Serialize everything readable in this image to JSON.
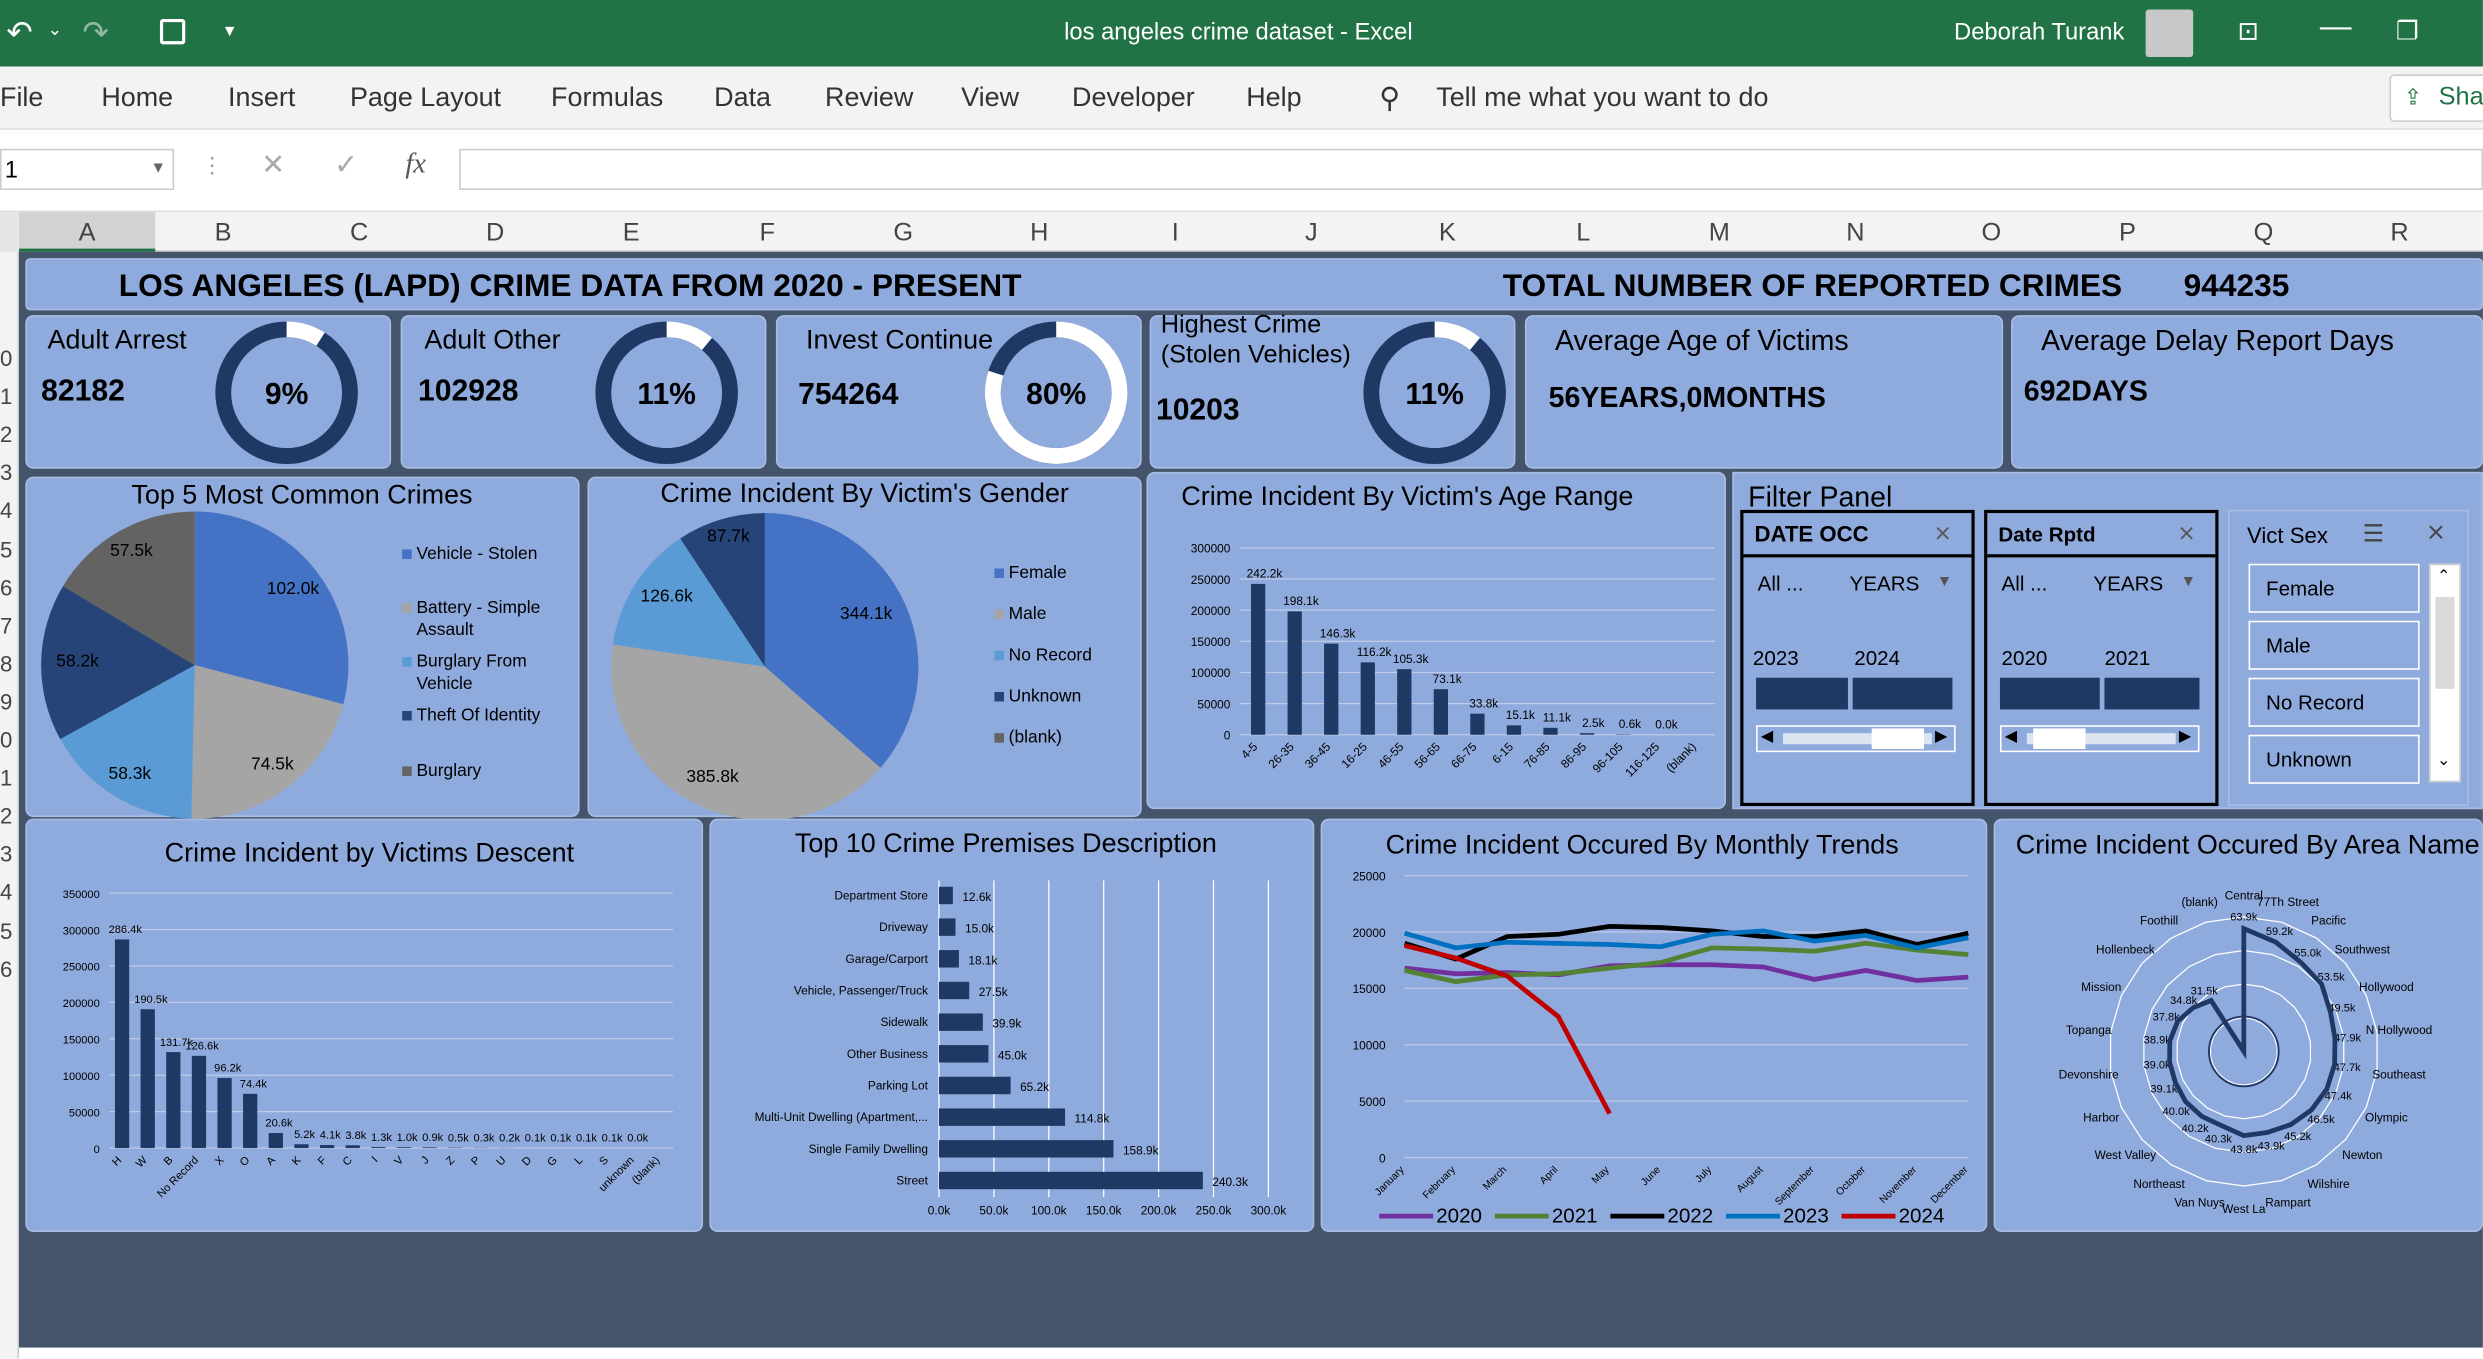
{
  "window": {
    "title": "los angeles crime dataset  -  Excel",
    "user": "Deborah Turank"
  },
  "ribbon": {
    "tabs": [
      "File",
      "Home",
      "Insert",
      "Page Layout",
      "Formulas",
      "Data",
      "Review",
      "View",
      "Developer",
      "Help"
    ],
    "tell_me": "Tell me what you want to do",
    "share": "Sha"
  },
  "formula_bar": {
    "name_box": "1",
    "fx": "fx",
    "value": ""
  },
  "columns": [
    "A",
    "B",
    "C",
    "D",
    "E",
    "F",
    "G",
    "H",
    "I",
    "J",
    "K",
    "L",
    "M",
    "N",
    "O",
    "P",
    "Q",
    "R"
  ],
  "rows": [
    "0",
    "1",
    "2",
    "3",
    "4",
    "5",
    "6",
    "7",
    "8",
    "9",
    "0",
    "1",
    "2",
    "3",
    "4",
    "5",
    "6"
  ],
  "dashboard": {
    "title": "LOS ANGELES (LAPD) CRIME DATA FROM 2020 - PRESENT",
    "total_label": "TOTAL NUMBER OF REPORTED CRIMES",
    "total_value": "944235",
    "kpis": [
      {
        "label": "Adult Arrest",
        "value": "82182",
        "pct": "9%",
        "pct_value": 9
      },
      {
        "label": "Adult Other",
        "value": "102928",
        "pct": "11%",
        "pct_value": 11
      },
      {
        "label": "Invest Continue",
        "value": "754264",
        "pct": "80%",
        "pct_value": 80
      },
      {
        "label": "Highest Crime\n(Stolen Vehicles)",
        "label1": "Highest Crime",
        "label2": "(Stolen Vehicles)",
        "value": "10203",
        "pct": "11%",
        "pct_value": 11
      }
    ],
    "avg_age": {
      "label": "Average Age of Victims",
      "value": "56YEARS,0MONTHS"
    },
    "avg_delay": {
      "label": "Average Delay Report Days",
      "value": "692DAYS"
    },
    "filter_panel": {
      "title": "Filter Panel",
      "date_occ": {
        "title": "DATE OCC",
        "all": "All ...",
        "period": "YEARS",
        "years": [
          "2023",
          "2024"
        ]
      },
      "date_rptd": {
        "title": "Date Rptd",
        "all": "All ...",
        "period": "YEARS",
        "years": [
          "2020",
          "2021"
        ]
      },
      "vict_sex": {
        "title": "Vict Sex",
        "options": [
          "Female",
          "Male",
          "No Record",
          "Unknown"
        ]
      }
    }
  },
  "colors": {
    "excel_green": "#217346",
    "card": "#8faadc",
    "canvas": "#44546a",
    "navy": "#1f3864"
  },
  "chart_data": [
    {
      "type": "pie",
      "title": "Top 5 Most Common Crimes",
      "categories": [
        "Vehicle - Stolen",
        "Battery - Simple Assault",
        "Burglary From Vehicle",
        "Theft Of Identity",
        "Burglary"
      ],
      "values": [
        102.0,
        74.5,
        58.3,
        58.2,
        57.5
      ],
      "labels": [
        "102.0k",
        "74.5k",
        "58.3k",
        "58.2k",
        "57.5k"
      ],
      "legend_lines": [
        [
          "Vehicle - Stolen"
        ],
        [
          "Battery - Simple",
          "Assault"
        ],
        [
          "Burglary From",
          "Vehicle"
        ],
        [
          "Theft Of Identity"
        ],
        [
          "Burglary"
        ]
      ],
      "colors": [
        "#4472c4",
        "#a5a5a5",
        "#5b9bd5",
        "#264478",
        "#636363"
      ]
    },
    {
      "type": "pie",
      "title": "Crime Incident By Victim's Gender",
      "categories": [
        "Female",
        "Male",
        "No Record",
        "Unknown",
        "(blank)"
      ],
      "values": [
        344.1,
        385.8,
        126.6,
        87.7,
        0
      ],
      "labels": [
        "344.1k",
        "385.8k",
        "126.6k",
        "87.7k",
        ""
      ],
      "colors": [
        "#4472c4",
        "#a5a5a5",
        "#5b9bd5",
        "#264478",
        "#636363"
      ]
    },
    {
      "type": "bar",
      "title": "Crime Incident By Victim's Age Range",
      "categories": [
        "4-5",
        "26-35",
        "36-45",
        "16-25",
        "46-55",
        "56-65",
        "66-75",
        "6-15",
        "76-85",
        "86-95",
        "96-105",
        "116-125",
        "(blank)"
      ],
      "values": [
        242.2,
        198.1,
        146.3,
        116.2,
        105.3,
        73.1,
        33.8,
        15.1,
        11.1,
        2.5,
        0.6,
        0.0,
        0
      ],
      "labels": [
        "242.2k",
        "198.1k",
        "146.3k",
        "116.2k",
        "105.3k",
        "73.1k",
        "33.8k",
        "15.1k",
        "11.1k",
        "2.5k",
        "0.6k",
        "0.0k",
        ""
      ],
      "ylim": [
        0,
        300000
      ],
      "yticks": [
        "0",
        "50000",
        "100000",
        "150000",
        "200000",
        "250000",
        "300000"
      ]
    },
    {
      "type": "bar",
      "title": "Crime Incident by  Victims Descent",
      "categories": [
        "H",
        "W",
        "B",
        "No Record",
        "X",
        "O",
        "A",
        "K",
        "F",
        "C",
        "I",
        "V",
        "J",
        "Z",
        "P",
        "U",
        "D",
        "G",
        "L",
        "S",
        "unknown",
        "(blank)"
      ],
      "values": [
        286.4,
        190.5,
        131.7,
        126.6,
        96.2,
        74.4,
        20.6,
        5.2,
        4.1,
        3.8,
        1.3,
        1.0,
        0.9,
        0.5,
        0.3,
        0.2,
        0.1,
        0.1,
        0.1,
        0.1,
        0.0,
        0
      ],
      "labels": [
        "286.4k",
        "190.5k",
        "131.7k",
        "126.6k",
        "96.2k",
        "74.4k",
        "20.6k",
        "5.2k",
        "4.1k",
        "3.8k",
        "1.3k",
        "1.0k",
        "0.9k",
        "0.5k",
        "0.3k",
        "0.2k",
        "0.1k",
        "0.1k",
        "0.1k",
        "0.1k",
        "0.0k",
        ""
      ],
      "ylim": [
        0,
        350000
      ],
      "yticks": [
        "0",
        "50000",
        "100000",
        "150000",
        "200000",
        "250000",
        "300000",
        "350000"
      ]
    },
    {
      "type": "bar",
      "orientation": "horizontal",
      "title": "Top 10 Crime Premises Description",
      "categories": [
        "Department Store",
        "Driveway",
        "Garage/Carport",
        "Vehicle, Passenger/Truck",
        "Sidewalk",
        "Other Business",
        "Parking Lot",
        "Multi-Unit Dwelling (Apartment,...",
        "Single Family Dwelling",
        "Street"
      ],
      "values": [
        12.6,
        15.0,
        18.1,
        27.5,
        39.9,
        45.0,
        65.2,
        114.8,
        158.9,
        240.3
      ],
      "labels": [
        "12.6k",
        "15.0k",
        "18.1k",
        "27.5k",
        "39.9k",
        "45.0k",
        "65.2k",
        "114.8k",
        "158.9k",
        "240.3k"
      ],
      "xlim": [
        0,
        300
      ],
      "xticks": [
        "0.0k",
        "50.0k",
        "100.0k",
        "150.0k",
        "200.0k",
        "250.0k",
        "300.0k"
      ]
    },
    {
      "type": "line",
      "title": "Crime Incident Occured By Monthly Trends",
      "categories": [
        "January",
        "February",
        "March",
        "April",
        "May",
        "June",
        "July",
        "August",
        "September",
        "October",
        "November",
        "December"
      ],
      "ylim": [
        0,
        25000
      ],
      "yticks": [
        "0",
        "5000",
        "10000",
        "15000",
        "20000",
        "25000"
      ],
      "series": [
        {
          "name": "2020",
          "color": "#7030a0",
          "values": [
            16800,
            16300,
            16400,
            16200,
            17000,
            17100,
            17100,
            16900,
            15800,
            16600,
            15700,
            16000
          ]
        },
        {
          "name": "2021",
          "color": "#548235",
          "values": [
            16600,
            15600,
            16200,
            16300,
            16800,
            17300,
            18600,
            18500,
            18300,
            19000,
            18400,
            18000
          ]
        },
        {
          "name": "2022",
          "color": "#000000",
          "values": [
            19000,
            17600,
            19600,
            19800,
            20500,
            20400,
            20100,
            19600,
            19600,
            20100,
            18900,
            19900
          ]
        },
        {
          "name": "2023",
          "color": "#0070c0",
          "values": [
            19900,
            18600,
            19100,
            19000,
            18900,
            18700,
            19800,
            20100,
            19200,
            19700,
            18600,
            19500
          ]
        },
        {
          "name": "2024",
          "color": "#c00000",
          "values": [
            18800,
            17700,
            16100,
            12500,
            3900
          ]
        }
      ]
    },
    {
      "type": "radar",
      "title": "Crime Incident Occured By Area Name",
      "categories": [
        "Central",
        "77Th Street",
        "Pacific",
        "Southwest",
        "Hollywood",
        "N Hollywood",
        "Southeast",
        "Olympic",
        "Newton",
        "Wilshire",
        "Rampart",
        "West La",
        "Van Nuys",
        "Northeast",
        "West Valley",
        "Harbor",
        "Devonshire",
        "Topanga",
        "Mission",
        "Hollenbeck",
        "Foothill",
        "(blank)"
      ],
      "values": [
        63.9,
        59.2,
        55.0,
        53.5,
        49.5,
        47.9,
        47.7,
        47.4,
        46.5,
        45.2,
        43.9,
        43.8,
        40.3,
        40.2,
        40.0,
        39.1,
        39.0,
        38.9,
        37.8,
        34.8,
        31.5,
        0
      ],
      "labels": [
        "63.9k",
        "59.2k",
        "55.0k",
        "53.5k",
        "49.5k",
        "47.9k",
        "47.7k",
        "47.4k",
        "46.5k",
        "45.2k",
        "43.9k",
        "43.8k",
        "40.3k",
        "40.2k",
        "40.0k",
        "39.1k",
        "39.0k",
        "38.9k",
        "37.8k",
        "34.8k",
        "31.5k",
        ""
      ]
    }
  ]
}
